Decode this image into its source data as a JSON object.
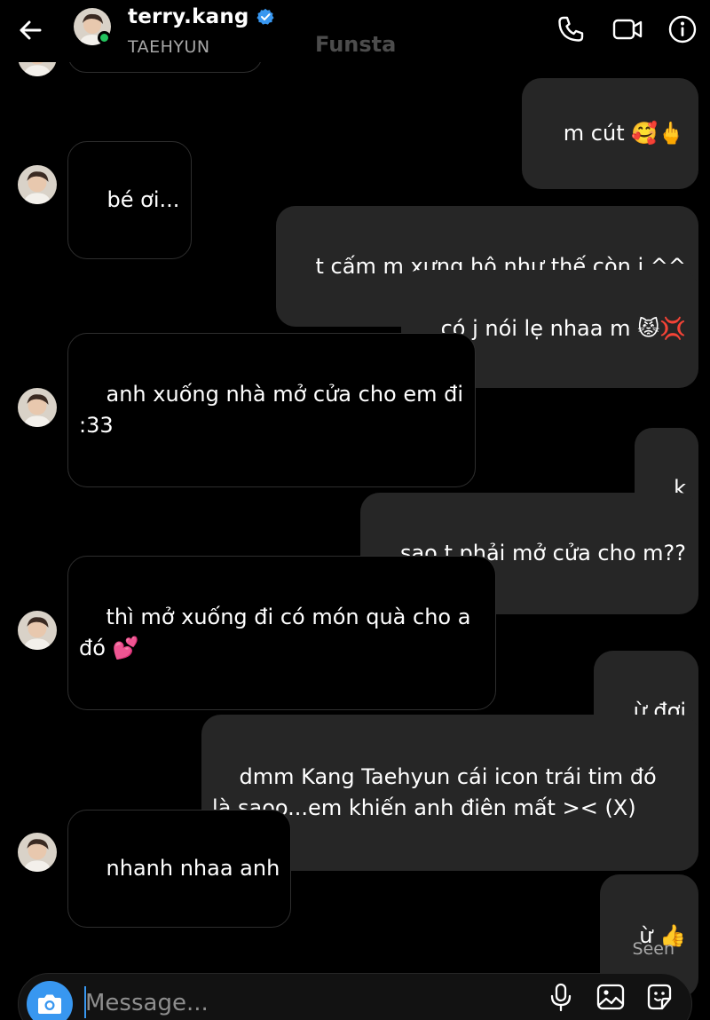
{
  "header": {
    "display_name": "terry.kang",
    "username": "TAEHYUN",
    "list_label": "Funsta",
    "verified": true
  },
  "messages": [
    {
      "from": "me",
      "text": "m cút 🥰🖕"
    },
    {
      "from": "them",
      "text": "bé ơi..."
    },
    {
      "from": "me",
      "text": "t cấm m xưng hô như thế còn j ^^"
    },
    {
      "from": "me",
      "text": "có j nói lẹ nhaa m 😾💢"
    },
    {
      "from": "them",
      "text": "anh xuống nhà mở cửa cho em đi\n:33"
    },
    {
      "from": "me",
      "text": "k"
    },
    {
      "from": "me",
      "text": "sao t phải mở cửa cho m??"
    },
    {
      "from": "them",
      "text": "thì mở xuống đi có món quà cho a\nđó 💕"
    },
    {
      "from": "me",
      "text": "ừ đợi"
    },
    {
      "from": "me",
      "text": "dmm Kang Taehyun cái icon trái tim đó\nlà saoo...em khiến anh điên mất >< (X)"
    },
    {
      "from": "them",
      "text": "nhanh nhaa anh"
    },
    {
      "from": "me",
      "text": "ừ 👍"
    }
  ],
  "status": {
    "seen": "Seen"
  },
  "composer": {
    "placeholder": "Message..."
  },
  "colors": {
    "background": "#000000",
    "outgoing_bubble": "#262626",
    "incoming_border": "#2e2e2e",
    "accent": "#3897f0",
    "online": "#23c45e",
    "verified": "#3897f0"
  },
  "icons": [
    "back-arrow-icon",
    "verified-badge-icon",
    "phone-icon",
    "video-call-icon",
    "info-icon",
    "camera-icon",
    "microphone-icon",
    "gallery-icon",
    "sticker-icon"
  ]
}
